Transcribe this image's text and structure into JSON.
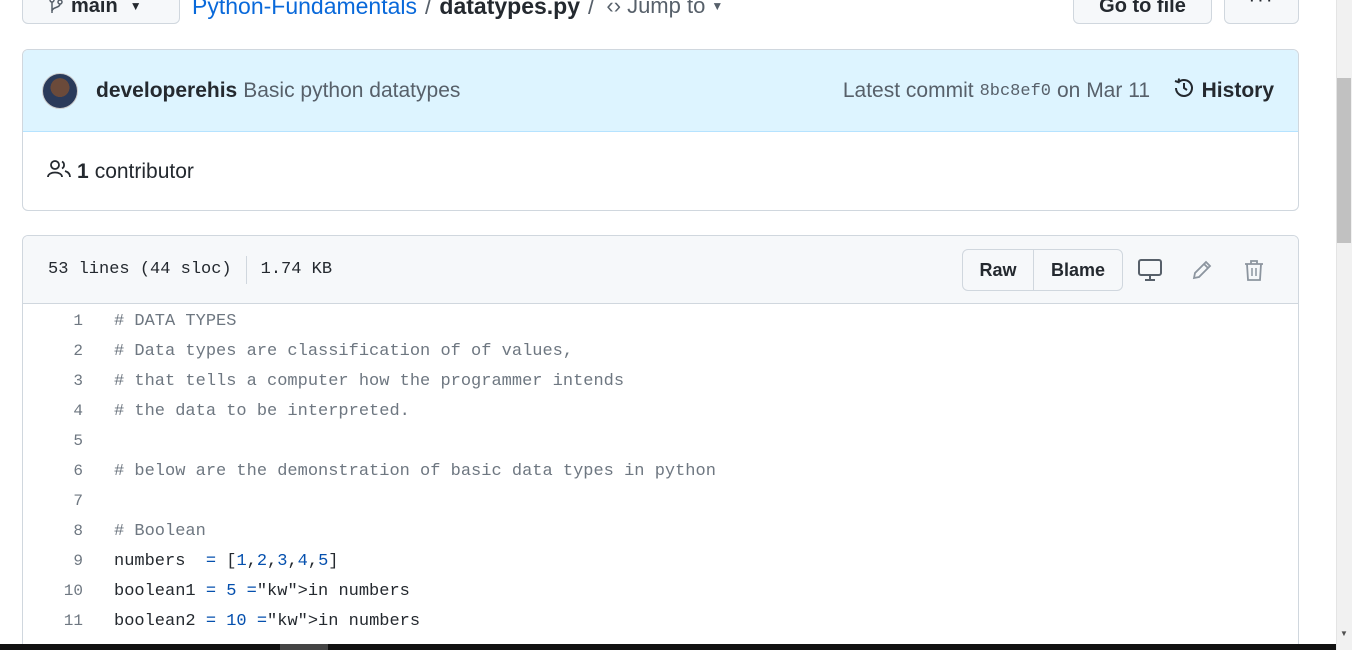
{
  "topbar": {
    "branch": "main",
    "repo": "Python-Fundamentals",
    "separator": "/",
    "file": "datatypes.py",
    "jump_to": "Jump to",
    "go_to_file": "Go to file",
    "more": "···"
  },
  "commit": {
    "author": "developerehis",
    "message": "Basic python datatypes",
    "latest_label": "Latest commit",
    "sha": "8bc8ef0",
    "date": "on Mar 11",
    "history_label": "History"
  },
  "contributors": {
    "count": "1",
    "label": "contributor"
  },
  "file_info": {
    "lines": "53 lines (44 sloc)",
    "size": "1.74 KB",
    "raw_label": "Raw",
    "blame_label": "Blame"
  },
  "code_lines": [
    {
      "n": "1",
      "text": "# DATA TYPES"
    },
    {
      "n": "2",
      "text": "# Data types are classification of of values,"
    },
    {
      "n": "3",
      "text": "# that tells a computer how the programmer intends"
    },
    {
      "n": "4",
      "text": "# the data to be interpreted."
    },
    {
      "n": "5",
      "text": ""
    },
    {
      "n": "6",
      "text": "# below are the demonstration of basic data types in python"
    },
    {
      "n": "7",
      "text": ""
    },
    {
      "n": "8",
      "text": "# Boolean"
    },
    {
      "n": "9",
      "text": "numbers  = [1,2,3,4,5]"
    },
    {
      "n": "10",
      "text": "boolean1 = 5 in numbers"
    },
    {
      "n": "11",
      "text": "boolean2 = 10 in numbers"
    }
  ],
  "colors": {
    "link": "#0969da",
    "commit_bg": "#ddf4ff",
    "comment": "#6e7781",
    "keyword": "#0550ae"
  }
}
